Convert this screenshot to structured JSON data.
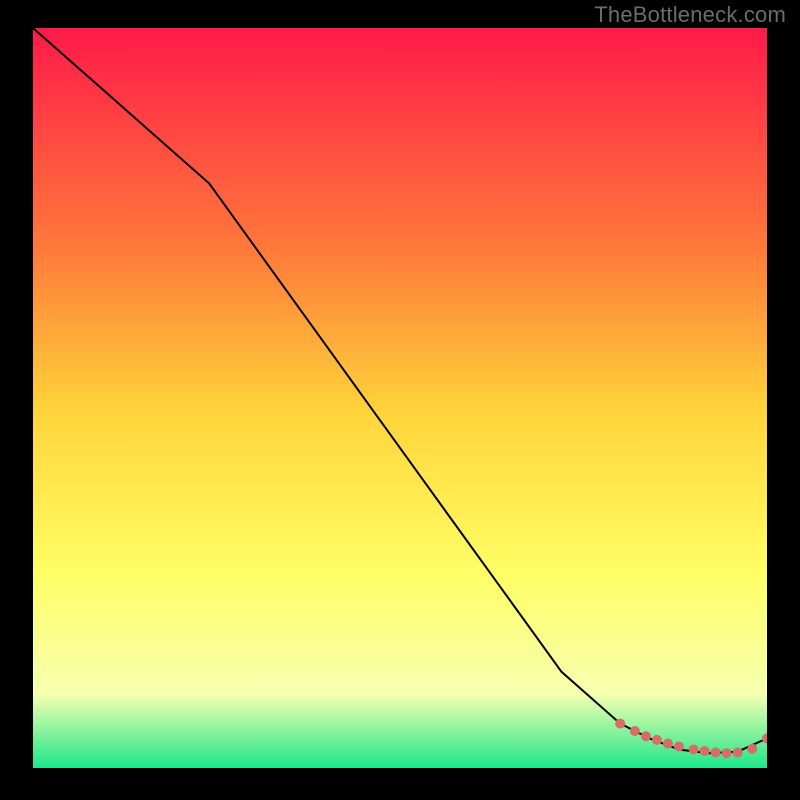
{
  "watermark": "TheBottleneck.com",
  "colors": {
    "gradient_top": "#ff1a49",
    "gradient_mid_upper": "#ff7a3a",
    "gradient_mid": "#ffd43a",
    "gradient_mid_lower": "#ffff66",
    "gradient_lower": "#f6ffb0",
    "gradient_bottom": "#1ee68a",
    "curve": "#000000",
    "marker": "#d86c66",
    "frame": "#000000"
  },
  "chart_data": {
    "type": "line",
    "title": "",
    "xlabel": "",
    "ylabel": "",
    "xlim": [
      0,
      100
    ],
    "ylim": [
      0,
      100
    ],
    "series": [
      {
        "name": "bottleneck-curve",
        "x": [
          0,
          8,
          16,
          24,
          32,
          40,
          48,
          56,
          64,
          72,
          80,
          84,
          88,
          92,
          96,
          100
        ],
        "y": [
          100,
          93,
          86,
          79,
          68,
          57,
          46,
          35,
          24,
          13,
          6,
          4,
          2.5,
          2,
          2.2,
          4
        ]
      }
    ],
    "markers": {
      "name": "gpu-points",
      "x": [
        80,
        82,
        83.5,
        85,
        86.5,
        88,
        90,
        91.5,
        93,
        94.5,
        96,
        98,
        100
      ],
      "y": [
        6.0,
        5.0,
        4.3,
        3.8,
        3.3,
        2.9,
        2.5,
        2.3,
        2.1,
        2.0,
        2.1,
        2.6,
        4.0
      ]
    }
  }
}
